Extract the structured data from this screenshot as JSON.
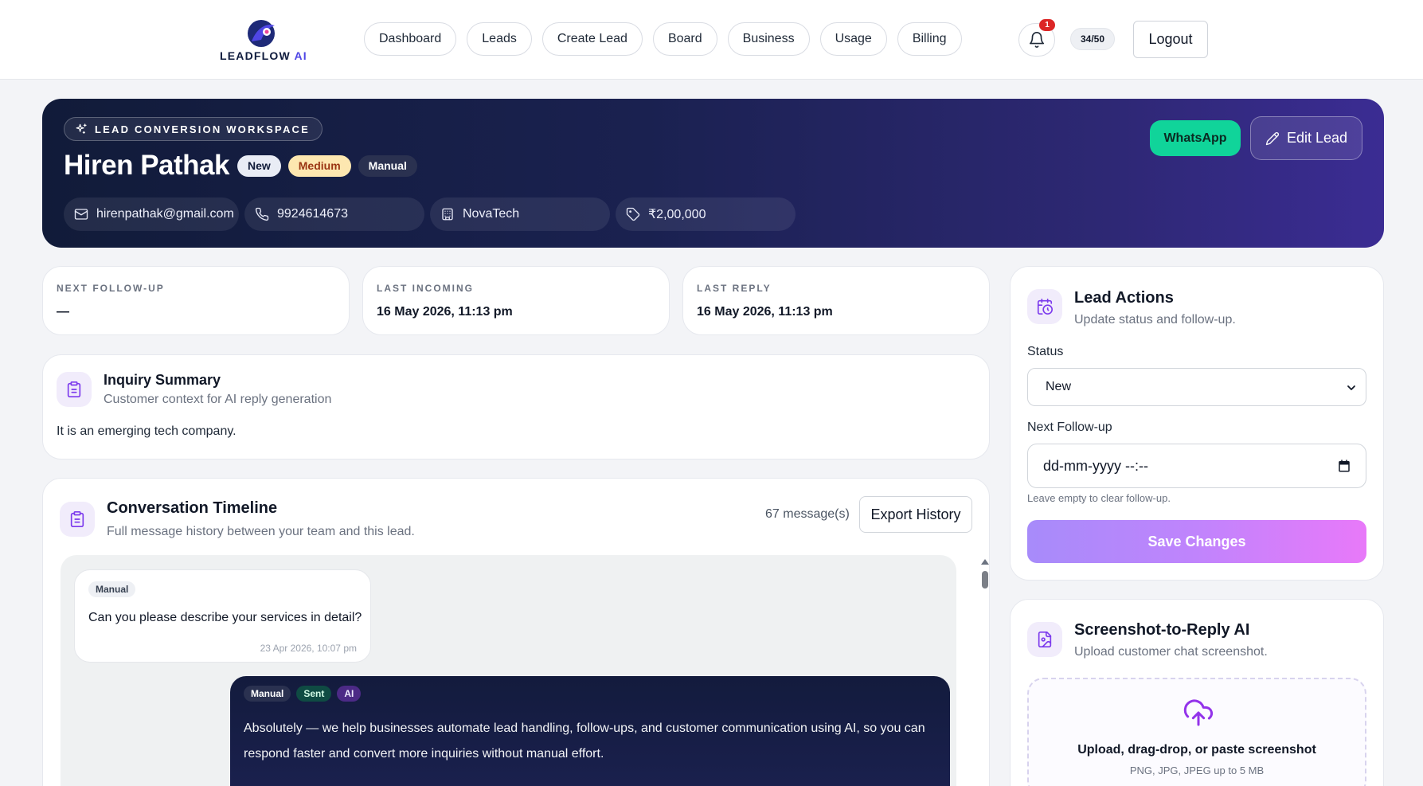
{
  "brand": {
    "name": "LEADFLOW",
    "suffix": "AI"
  },
  "nav": {
    "items": [
      "Dashboard",
      "Leads",
      "Create Lead",
      "Board",
      "Business",
      "Usage",
      "Billing"
    ],
    "notification_count": "1",
    "usage": "34/50",
    "logout_label": "Logout"
  },
  "hero": {
    "tag": "LEAD CONVERSION WORKSPACE",
    "name": "Hiren Pathak",
    "badges": {
      "status": "New",
      "priority": "Medium",
      "source": "Manual"
    },
    "email": "hirenpathak@gmail.com",
    "phone": "9924614673",
    "company": "NovaTech",
    "value": "₹2,00,000",
    "whatsapp_label": "WhatsApp",
    "edit_label": "Edit Lead"
  },
  "stats": {
    "next_followup": {
      "label": "NEXT FOLLOW-UP",
      "value": "—"
    },
    "last_incoming": {
      "label": "LAST INCOMING",
      "value": "16 May 2026, 11:13 pm"
    },
    "last_reply": {
      "label": "LAST REPLY",
      "value": "16 May 2026, 11:13 pm"
    }
  },
  "inquiry": {
    "title": "Inquiry Summary",
    "subtitle": "Customer context for AI reply generation",
    "body": "It is an emerging tech company."
  },
  "timeline": {
    "title": "Conversation Timeline",
    "subtitle": "Full message history between your team and this lead.",
    "count": "67 message(s)",
    "export_label": "Export History",
    "messages": [
      {
        "direction": "incoming",
        "badges": [
          "Manual"
        ],
        "text": "Can you please describe your services in detail?",
        "time": "23 Apr 2026, 10:07 pm"
      },
      {
        "direction": "outgoing",
        "badges": [
          "Manual",
          "Sent",
          "AI"
        ],
        "text_line1": "Absolutely — we help businesses automate lead handling, follow-ups, and customer communication using AI, so you can",
        "text_line2": "respond faster and convert more inquiries without manual effort."
      }
    ]
  },
  "actions": {
    "title": "Lead Actions",
    "subtitle": "Update status and follow-up.",
    "status_label": "Status",
    "status_value": "New",
    "followup_label": "Next Follow-up",
    "followup_placeholder": "dd-mm-yyyy --:--",
    "followup_hint": "Leave empty to clear follow-up.",
    "save_label": "Save Changes"
  },
  "screenshot_ai": {
    "title": "Screenshot-to-Reply AI",
    "subtitle": "Upload customer chat screenshot.",
    "upload_title": "Upload, drag-drop, or paste screenshot",
    "upload_hint": "PNG, JPG, JPEG up to 5 MB"
  },
  "colors": {
    "accent": "#7c3aed",
    "hero_dark": "#111b39",
    "hero_purple": "#3b2c93",
    "whatsapp": "#10d49a",
    "badge_red": "#dc2626"
  },
  "icons": [
    "bell-icon",
    "mail-icon",
    "phone-icon",
    "building-icon",
    "tag-icon",
    "sparkle-icon",
    "pencil-icon",
    "clipboard-icon",
    "calendar-clock-icon",
    "file-image-icon",
    "upload-cloud-icon",
    "chevron-down-icon",
    "calendar-icon"
  ]
}
